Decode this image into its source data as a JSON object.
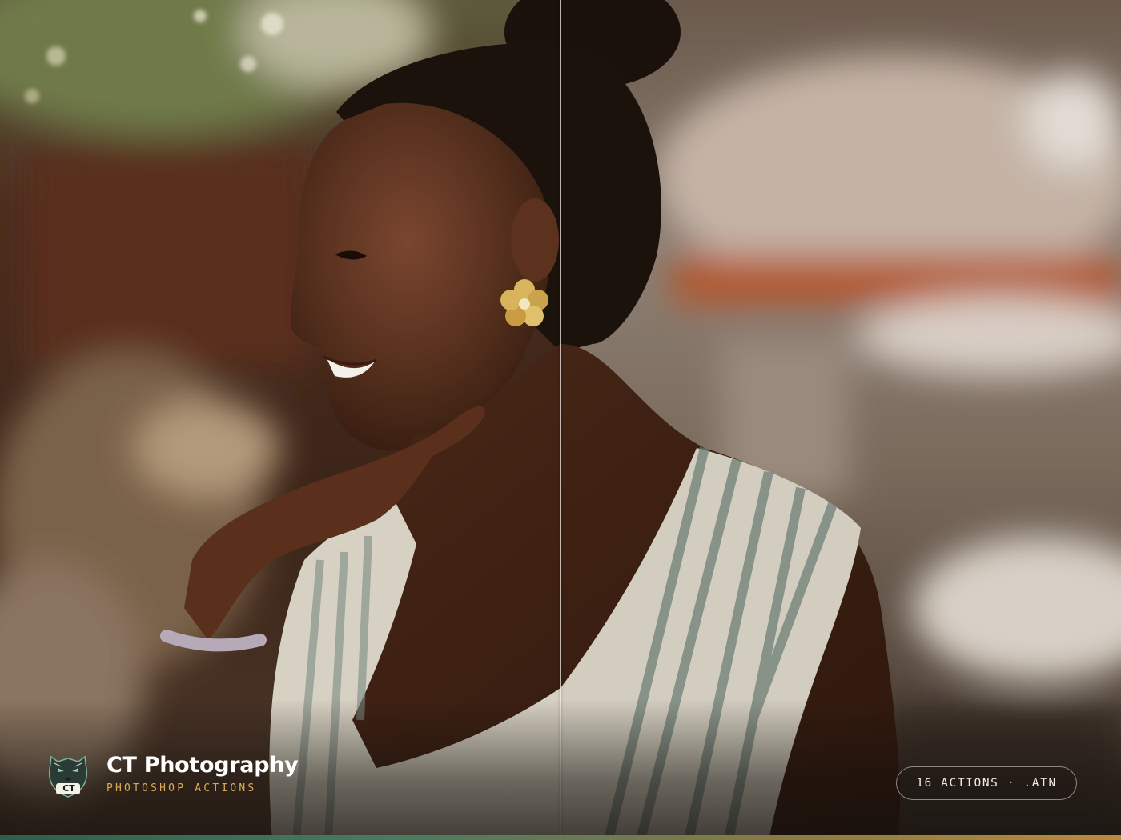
{
  "brand": {
    "name": "CT Photography",
    "subtitle": "PHOTOSHOP ACTIONS",
    "logo_icon": "panther-head-logo-icon",
    "logo_text": "CT"
  },
  "badge": {
    "label": "16 ACTIONS · .ATN"
  },
  "colors": {
    "accent_gold": "#d8a95a",
    "accent_green": "#2f5d4e",
    "text_white": "#ffffff"
  }
}
